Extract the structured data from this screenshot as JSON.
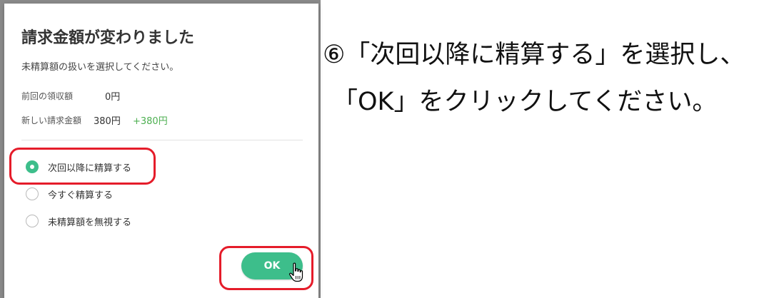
{
  "dialog": {
    "title": "請求金額が変わりました",
    "description": "未精算額の扱いを選択してください。",
    "previous_label": "前回の領収額",
    "previous_value": "0円",
    "new_label": "新しい請求金額",
    "new_value": "380円",
    "difference": "+380円",
    "options": [
      {
        "label": "次回以降に精算する",
        "checked": true
      },
      {
        "label": "今すぐ精算する",
        "checked": false
      },
      {
        "label": "未精算額を無視する",
        "checked": false
      }
    ],
    "ok_label": "OK"
  },
  "instruction": {
    "line1": "⑥「次回以降に精算する」を選択し、",
    "line2": "「OK」をクリックしてください。"
  },
  "colors": {
    "accent": "#3dbe8b",
    "highlight": "#e51c2a",
    "positive": "#4caf50"
  },
  "icons": {
    "cursor": "hand-pointer-icon"
  }
}
